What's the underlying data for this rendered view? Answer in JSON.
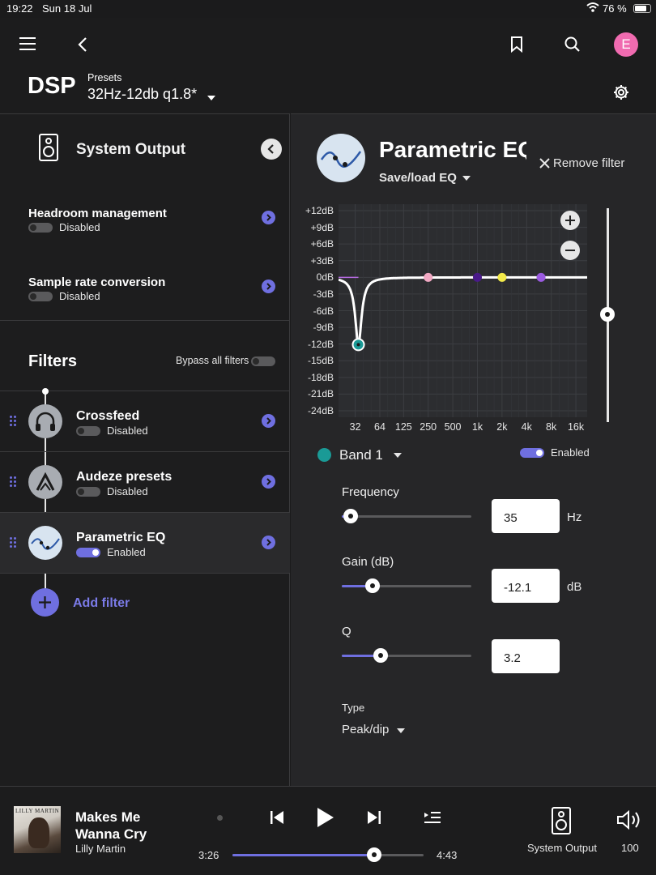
{
  "status": {
    "time": "19:22",
    "date": "Sun 18 Jul",
    "battery": "76 %"
  },
  "header": {
    "title": "DSP",
    "presets_label": "Presets",
    "preset_value": "32Hz-12db q1.8*",
    "avatar_initial": "E",
    "icons": [
      "menu-icon",
      "back-icon",
      "bookmark-icon",
      "search-icon",
      "settings-icon"
    ]
  },
  "left": {
    "output_title": "System Output",
    "headroom": {
      "label": "Headroom management",
      "status": "Disabled",
      "enabled": false
    },
    "sample_rate": {
      "label": "Sample rate conversion",
      "status": "Disabled",
      "enabled": false
    },
    "filters_title": "Filters",
    "bypass_label": "Bypass all filters",
    "filters": [
      {
        "name": "Crossfeed",
        "status": "Disabled",
        "enabled": false,
        "icon": "headphones-icon"
      },
      {
        "name": "Audeze presets",
        "status": "Disabled",
        "enabled": false,
        "icon": "audeze-icon"
      },
      {
        "name": "Parametric EQ",
        "status": "Enabled",
        "enabled": true,
        "icon": "eq-curve-icon"
      }
    ],
    "add_filter": "Add filter"
  },
  "right": {
    "title": "Parametric EQ",
    "save_load": "Save/load EQ",
    "remove_filter": "Remove filter",
    "band_label": "Band 1",
    "band_color": "#1a9a96",
    "band_enabled_label": "Enabled",
    "frequency_label": "Frequency",
    "frequency_value": "35",
    "frequency_unit": "Hz",
    "gain_label": "Gain (dB)",
    "gain_value": "-12.1",
    "gain_unit": "dB",
    "q_label": "Q",
    "q_value": "3.2",
    "type_label": "Type",
    "type_value": "Peak/dip"
  },
  "chart_data": {
    "type": "line",
    "ylabels": [
      "+12dB",
      "+9dB",
      "+6dB",
      "+3dB",
      "0dB",
      "-3dB",
      "-6dB",
      "-9dB",
      "-12dB",
      "-15dB",
      "-18dB",
      "-21dB",
      "-24dB"
    ],
    "xlabels": [
      "32",
      "64",
      "125",
      "250",
      "500",
      "1k",
      "2k",
      "4k",
      "8k",
      "16k"
    ],
    "ylim": [
      -24,
      12
    ],
    "log_x": true,
    "grid": true,
    "bands": [
      {
        "freq": 35,
        "gain": -12.1,
        "q": 3.2,
        "color": "#1a9a96",
        "selected": true
      },
      {
        "freq": 250,
        "gain": 0,
        "color": "#f2a9c4"
      },
      {
        "freq": 1000,
        "gain": 0,
        "color": "#4a1a8a"
      },
      {
        "freq": 2000,
        "gain": 0,
        "color": "#f3ea4a"
      },
      {
        "freq": 6000,
        "gain": 0,
        "color": "#9a5ae0"
      }
    ]
  },
  "sliders": {
    "frequency_level": 0.07,
    "gain_level": 0.24,
    "q_level": 0.3,
    "progress_level": 0.74
  },
  "player": {
    "album_text": "LILLY MARTIN",
    "track_title_line1": "Makes Me",
    "track_title_line2": "Wanna Cry",
    "artist": "Lilly Martin",
    "elapsed": "3:26",
    "total": "4:43",
    "output_label": "System Output",
    "volume": "100"
  },
  "colors": {
    "accent": "#6f6fe0",
    "avatar": "#f06bb0",
    "background": "#1b1b1c"
  }
}
